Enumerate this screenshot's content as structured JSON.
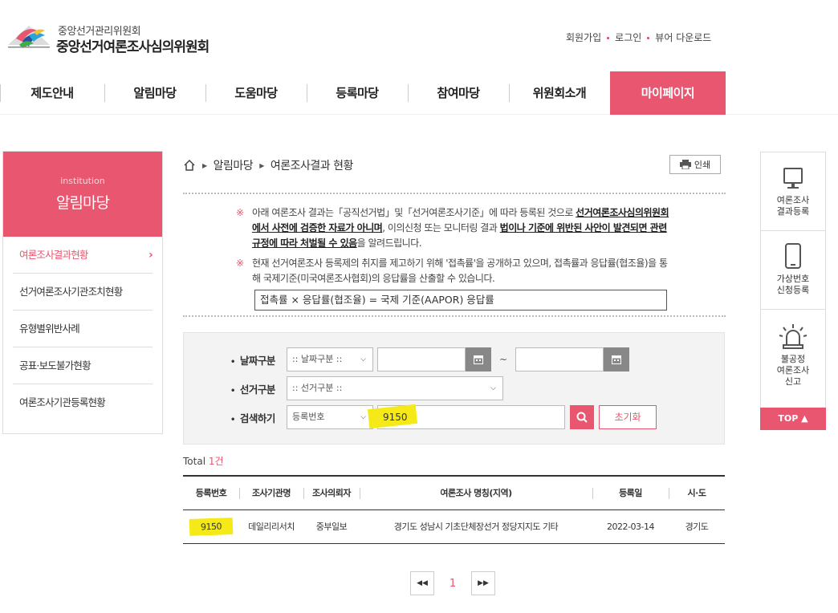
{
  "header": {
    "org_small": "중앙선거관리위원회",
    "org_big": "중앙선거여론조사심의위원회",
    "util_links": [
      "회원가입",
      "로그인",
      "뷰어 다운로드"
    ]
  },
  "gnb": {
    "items": [
      "제도안내",
      "알림마당",
      "도움마당",
      "등록마당",
      "참여마당",
      "위원회소개",
      "마이페이지"
    ],
    "active_index": 6
  },
  "lnb": {
    "sub": "institution",
    "title": "알림마당",
    "items": [
      "여론조사결과현황",
      "선거여론조사기관조치현황",
      "유형별위반사례",
      "공표·보도불가현황",
      "여론조사기관등록현황"
    ],
    "active_index": 0
  },
  "quick": {
    "items": [
      "여론조사\n결과등록",
      "가상번호\n신청등록",
      "불공정\n여론조사\n신고"
    ],
    "top_label": "TOP"
  },
  "breadcrumb": {
    "items": [
      "알림마당",
      "여론조사결과 현황"
    ],
    "print_label": "인쇄"
  },
  "notice": {
    "n1_pre": "아래 여론조사 결과는「공직선거법」및「선거여론조사기준」에 따라 등록된 것으로 ",
    "n1_u1": "선거여론조사심의위원회에서 사전에 검증한 자료가 아니며",
    "n1_mid": ", 이의신청 또는 모니터링 결과 ",
    "n1_u2": "법이나 기준에 위반된 사안이 발견되면 관련 규정에 따라 처벌될 수 있음",
    "n1_post": "을 알려드립니다.",
    "n2": "현재 선거여론조사 등록제의 취지를 제고하기 위해 '접촉률'을 공개하고 있으며, 접촉률과 응답률(협조율)을 통해 국제기준(미국여론조사협회)의 응답률을 산출할 수 있습니다.",
    "mark": "※",
    "formula": "접촉률 × 응답률(협조율) = 국제 기준(AAPOR) 응답률"
  },
  "search": {
    "date_label": "날짜구분",
    "date_select": ":: 날짜구분 ::",
    "date_sep": "~",
    "election_label": "선거구분",
    "election_select": ":: 선거구분 ::",
    "keyword_label": "검색하기",
    "keyword_type": "등록번호",
    "keyword_value": "9150",
    "reset_label": "초기화"
  },
  "total": {
    "label": "Total",
    "count": "1건"
  },
  "table": {
    "columns": [
      "등록번호",
      "조사기관명",
      "조사의뢰자",
      "여론조사 명칭(지역)",
      "등록일",
      "시·도"
    ],
    "rows": [
      [
        "9150",
        "데일리리서치",
        "중부일보",
        "경기도 성남시 기초단체장선거 정당지지도 기타",
        "2022-03-14",
        "경기도"
      ]
    ]
  },
  "pagination": {
    "current": "1"
  },
  "colors": {
    "accent": "#e8566f",
    "highlight": "#f5ea17"
  }
}
